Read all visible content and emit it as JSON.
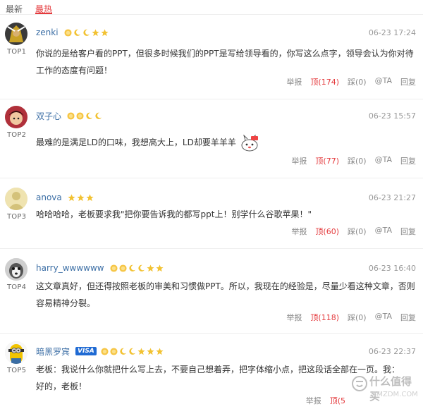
{
  "tabs": [
    {
      "label": "最新",
      "active": false
    },
    {
      "label": "最热",
      "active": true
    }
  ],
  "actions": {
    "report": "举报",
    "mention": "@TA",
    "reply": "回复"
  },
  "comments": [
    {
      "rank": "TOP1",
      "username": "zenki",
      "time": "06-23 17:24",
      "levels": [
        "sun",
        "moon",
        "moon",
        "star",
        "star"
      ],
      "content": "你说的是给客户看的PPT，但很多时候我们的PPT是写给领导看的，你写这么点字，领导会认为你对待工作的态度有问题！",
      "up": "顶(174)",
      "down": "踩(0)",
      "avatar_color": "#3a3a3a"
    },
    {
      "rank": "TOP2",
      "username": "双子心",
      "time": "06-23 15:57",
      "levels": [
        "sun",
        "sun",
        "moon",
        "moon"
      ],
      "content": "最难的是满足LD的口味，我想高大上，LD却要羊羊羊",
      "sticker": "bunny-sticker",
      "up": "顶(77)",
      "down": "踩(0)",
      "avatar_color": "#b0303a"
    },
    {
      "rank": "TOP3",
      "username": "anova",
      "time": "06-23 21:27",
      "levels": [
        "star",
        "star",
        "star"
      ],
      "content": "哈哈哈哈，老板要求我\"把你要告诉我的都写ppt上！别学什么谷歌苹果！\"",
      "up": "顶(60)",
      "down": "踩(0)",
      "avatar_color": "#e8d88a"
    },
    {
      "rank": "TOP4",
      "username": "harry_wwwwww",
      "time": "06-23 16:40",
      "levels": [
        "sun",
        "sun",
        "moon",
        "moon",
        "star",
        "star"
      ],
      "content": "这文章真好，但还得按照老板的审美和习惯做PPT。所以，我现在的经验是，尽量少看这种文章，否则容易精神分裂。",
      "up": "顶(118)",
      "down": "踩(0)",
      "avatar_color": "#555555"
    },
    {
      "rank": "TOP5",
      "username": "暗黑罗宾",
      "time": "06-23 22:37",
      "badge": "VISA",
      "levels": [
        "sun",
        "sun",
        "moon",
        "moon",
        "star",
        "star",
        "star"
      ],
      "content": "老板：我说什么你就把什么写上去，不要自己想着弄，把字体缩小点，把这段话全部在一页。我：好的，老板！",
      "up": "顶(5",
      "down": "",
      "avatar_color": "#f2c400"
    }
  ],
  "watermark": {
    "title": "什么值得买",
    "sub": "SMZDM.COM"
  }
}
